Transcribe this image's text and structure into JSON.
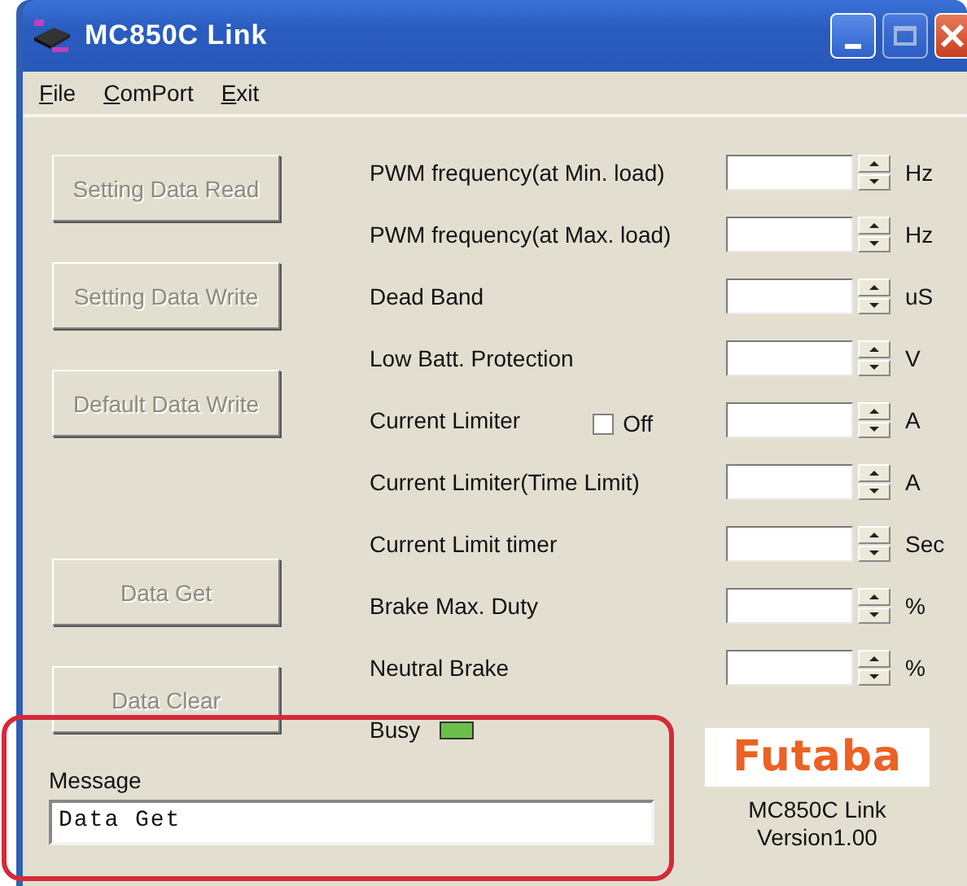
{
  "window": {
    "title": "MC850C Link"
  },
  "menu": [
    "File",
    "ComPort",
    "Exit"
  ],
  "buttons": [
    {
      "label": "Setting Data Read",
      "disabled": true
    },
    {
      "label": "Setting Data Write",
      "disabled": true
    },
    {
      "label": "Default Data Write",
      "disabled": true
    },
    {
      "label": "Data Get",
      "disabled": true
    },
    {
      "label": "Data Clear",
      "disabled": true
    }
  ],
  "settings": [
    {
      "kind": "spin",
      "label": "PWM frequency(at Min. load)",
      "unit": "Hz"
    },
    {
      "kind": "spin",
      "label": "PWM frequency(at Max. load)",
      "unit": "Hz"
    },
    {
      "kind": "spin",
      "label": "Dead Band",
      "unit": "uS"
    },
    {
      "kind": "spin",
      "label": "Low Batt. Protection",
      "unit": "V"
    },
    {
      "kind": "checkbox-spin",
      "label": "Current Limiter",
      "checkbox": {
        "label": "Off",
        "checked": false
      },
      "unit": "A"
    },
    {
      "kind": "spin",
      "label": "Current Limiter(Time Limit)",
      "unit": "A"
    },
    {
      "kind": "spin",
      "label": "Current Limit timer",
      "unit": "Sec"
    },
    {
      "kind": "spin",
      "label": "Brake Max. Duty",
      "unit": "%"
    },
    {
      "kind": "spin",
      "label": "Neutral Brake",
      "unit": "%"
    }
  ],
  "busy": {
    "label": "Busy",
    "color": "#6cbf4a"
  },
  "message": {
    "label": "Message",
    "value": "Data Get"
  },
  "about": {
    "logo": "Futaba",
    "product": "MC850C Link",
    "version": "Version1.00"
  }
}
